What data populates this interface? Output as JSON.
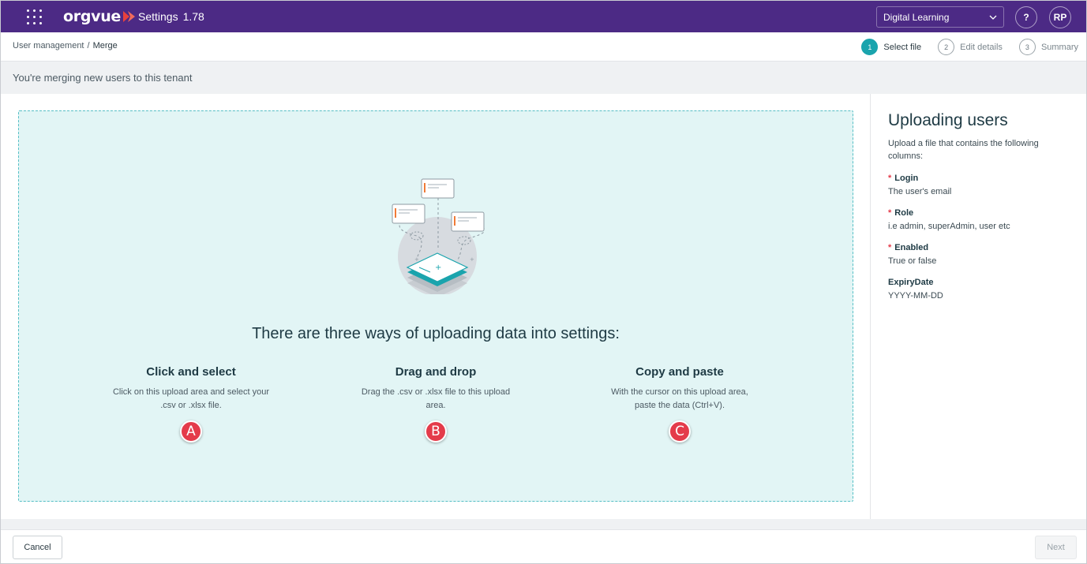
{
  "header": {
    "logo_text": "orgvue",
    "app_title": "Settings",
    "version": "1.78",
    "tenant": "Digital Learning",
    "help_label": "?",
    "user_initials": "RP"
  },
  "breadcrumb": {
    "parent": "User management",
    "separator": "/",
    "current": "Merge"
  },
  "steps": [
    {
      "num": "1",
      "label": "Select file",
      "active": true
    },
    {
      "num": "2",
      "label": "Edit details",
      "active": false
    },
    {
      "num": "3",
      "label": "Summary",
      "active": false
    }
  ],
  "info": "You're merging new users to this tenant",
  "dropzone": {
    "heading": "There are three ways of uploading data into settings:",
    "methods": [
      {
        "title": "Click and select",
        "desc": "Click on this upload area and select your .csv or .xlsx file.",
        "badge": "A"
      },
      {
        "title": "Drag and drop",
        "desc": "Drag the .csv or .xlsx file to this upload area.",
        "badge": "B"
      },
      {
        "title": "Copy and paste",
        "desc": "With the cursor on this upload area, paste the data (Ctrl+V).",
        "badge": "C"
      }
    ]
  },
  "sidebar": {
    "title": "Uploading users",
    "intro": "Upload a file that contains the following columns:",
    "required_mark": "*",
    "fields": [
      {
        "name": "Login",
        "desc": "The user's email",
        "required": true
      },
      {
        "name": "Role",
        "desc": "i.e admin, superAdmin, user etc",
        "required": true
      },
      {
        "name": "Enabled",
        "desc": "True or false",
        "required": true
      },
      {
        "name": "ExpiryDate",
        "desc": "YYYY-MM-DD",
        "required": false
      }
    ]
  },
  "footer": {
    "cancel_label": "Cancel",
    "next_label": "Next"
  },
  "colors": {
    "brand": "#4c2a85",
    "accent": "#1aa4ad",
    "badge": "#e43b4a",
    "dropzone_bg": "#e2f5f5"
  }
}
